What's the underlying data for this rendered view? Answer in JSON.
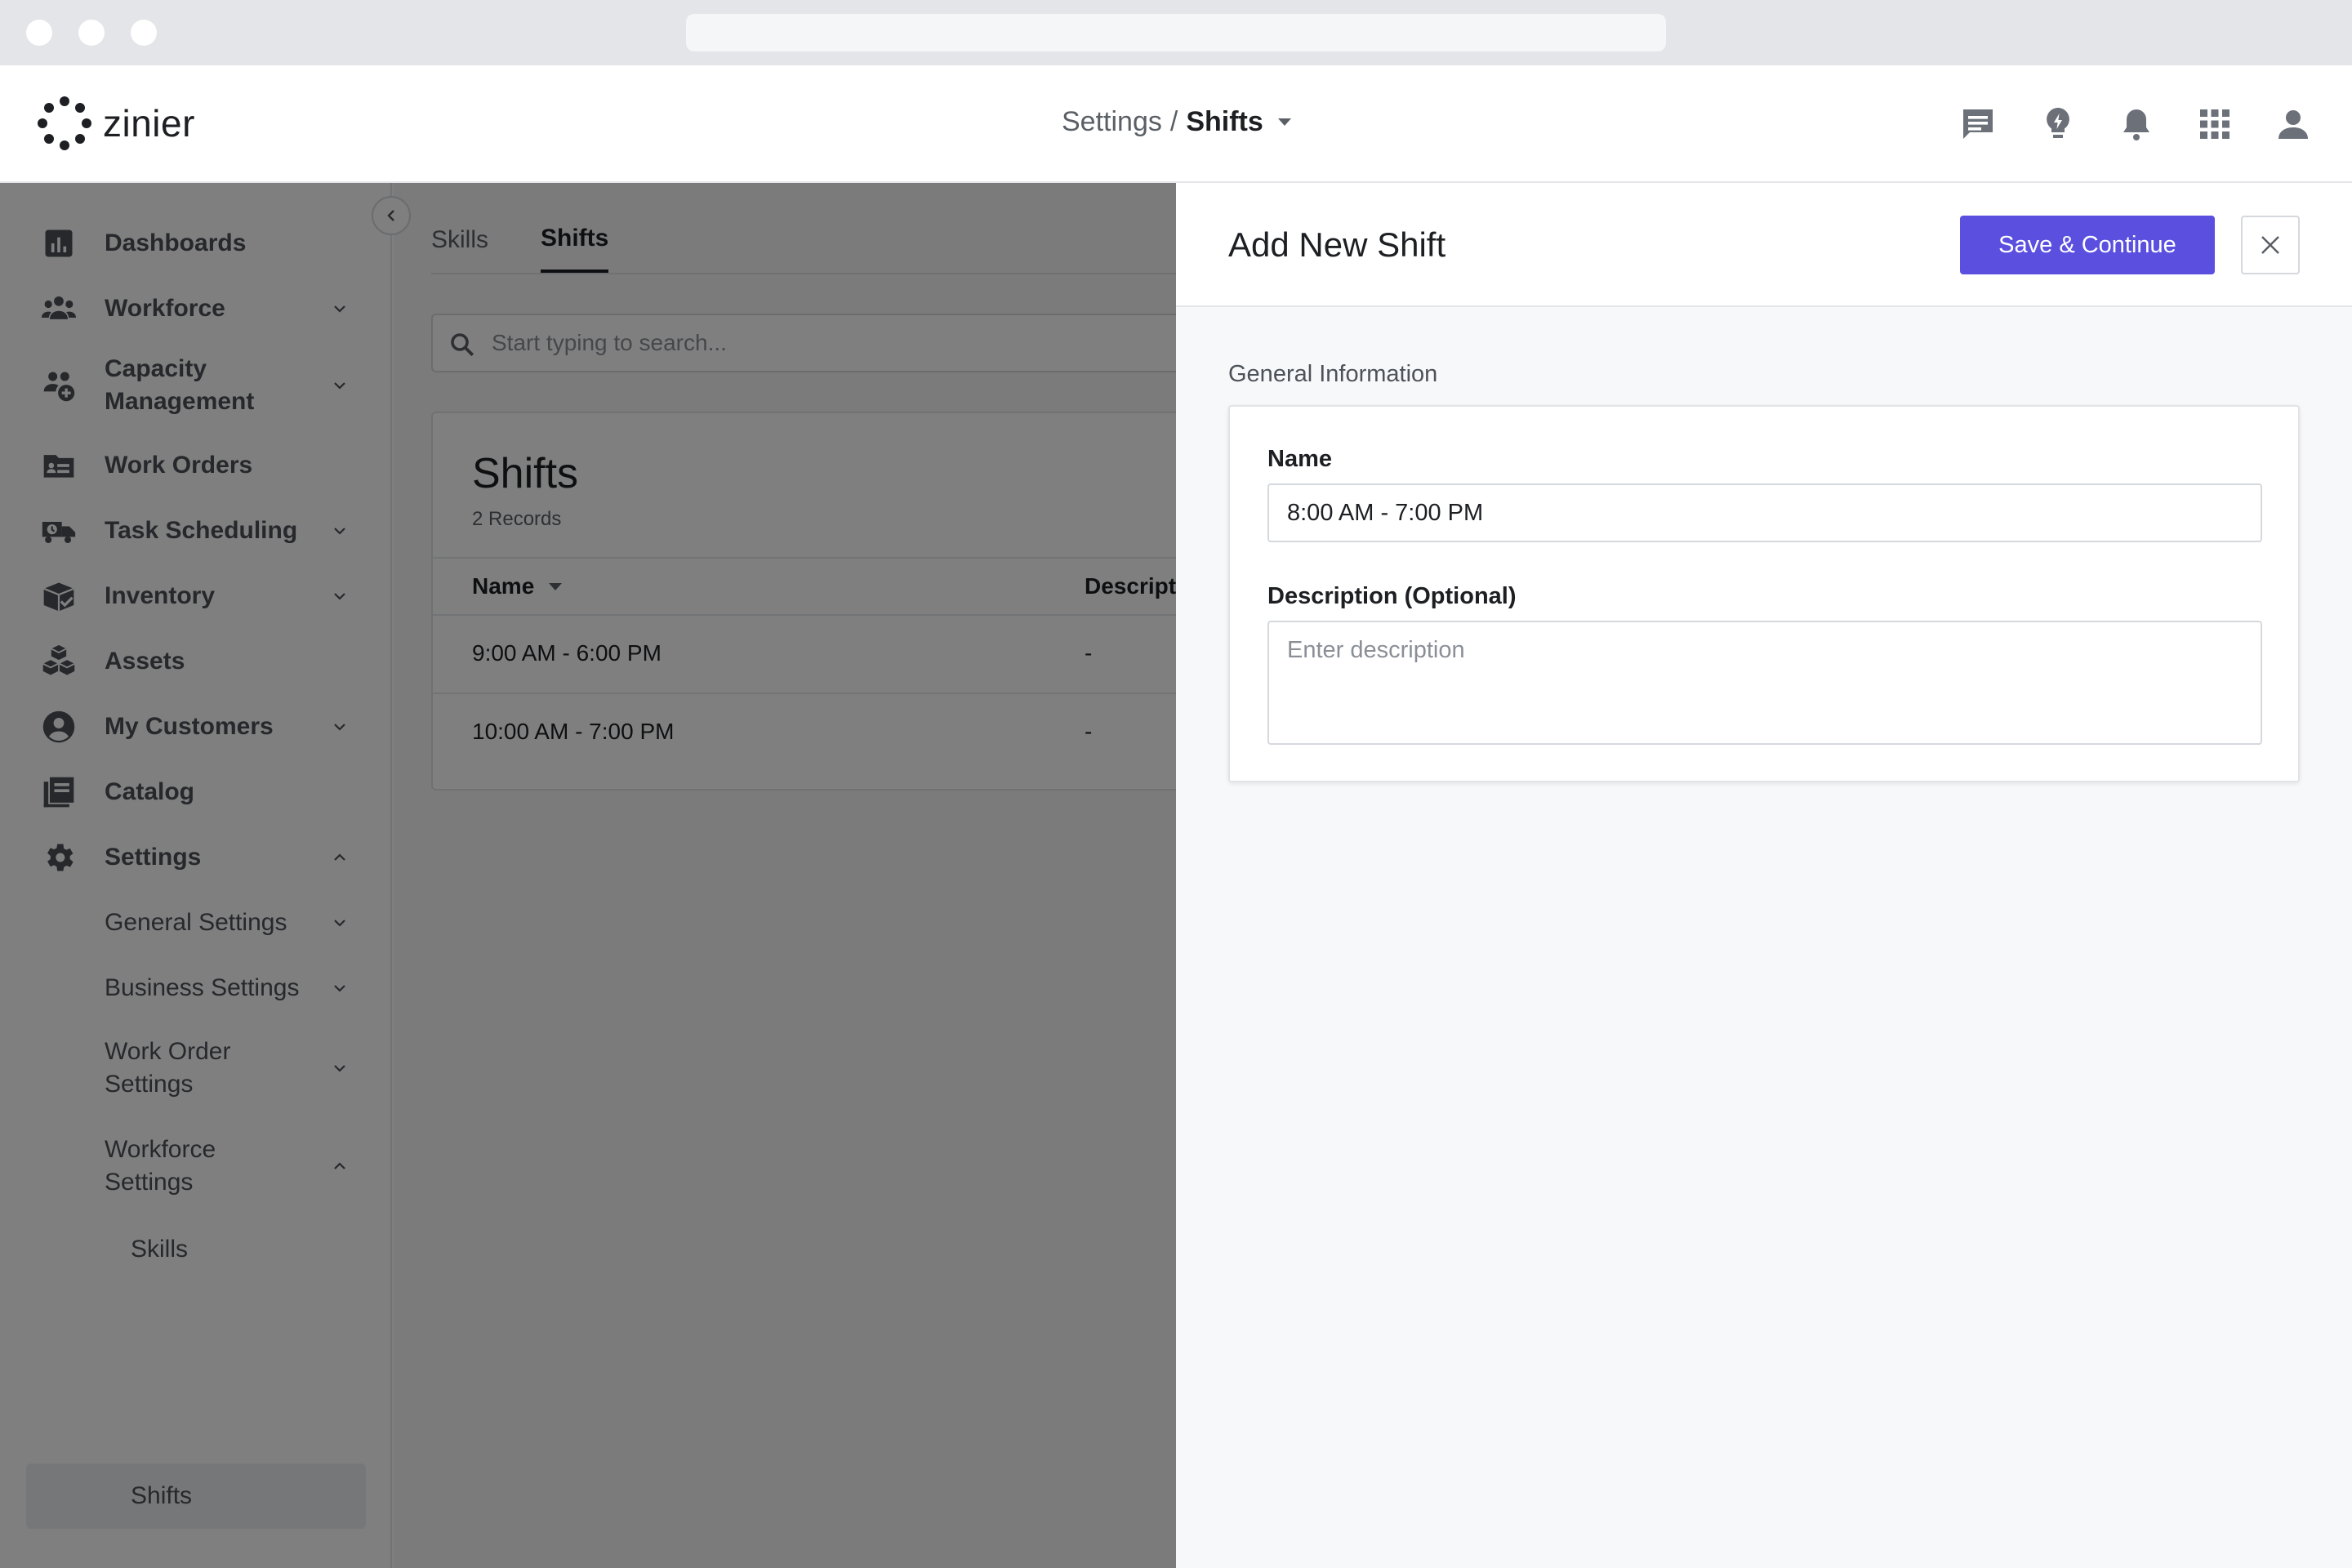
{
  "app": {
    "brand": "zinier"
  },
  "header": {
    "breadcrumb_parent": "Settings",
    "breadcrumb_sep": "/",
    "breadcrumb_current": "Shifts",
    "icons": [
      "chat-icon",
      "lightbulb-icon",
      "bell-icon",
      "apps-grid-icon",
      "user-icon"
    ]
  },
  "sidebar": {
    "items": [
      {
        "label": "Dashboards",
        "icon": "dashboard-icon"
      },
      {
        "label": "Workforce",
        "icon": "people-icon"
      },
      {
        "label_line1": "Capacity",
        "label_line2": "Management",
        "icon": "capacity-icon"
      },
      {
        "label": "Work Orders",
        "icon": "work-orders-icon"
      },
      {
        "label": "Task Scheduling",
        "icon": "truck-clock-icon"
      },
      {
        "label": "Inventory",
        "icon": "inventory-box-icon"
      },
      {
        "label": "Assets",
        "icon": "cubes-icon"
      },
      {
        "label": "My Customers",
        "icon": "customer-icon"
      },
      {
        "label": "Catalog",
        "icon": "book-icon"
      },
      {
        "label": "Settings",
        "icon": "gear-icon"
      }
    ],
    "settings_children": [
      {
        "label": "General Settings"
      },
      {
        "label": "Business Settings"
      },
      {
        "label_line1": "Work Order",
        "label_line2": "Settings"
      },
      {
        "label_line1": "Workforce",
        "label_line2": "Settings"
      }
    ],
    "workforce_children": [
      {
        "label": "Skills"
      },
      {
        "label": "Shifts"
      }
    ]
  },
  "main": {
    "tabs": [
      {
        "label": "Skills"
      },
      {
        "label": "Shifts"
      }
    ],
    "search_placeholder": "Start typing to search...",
    "card_title": "Shifts",
    "record_count": "2 Records",
    "columns": [
      {
        "label": "Name"
      },
      {
        "label": "Descript"
      }
    ],
    "rows": [
      {
        "name": "9:00 AM - 6:00 PM",
        "description": "-"
      },
      {
        "name": "10:00 AM - 7:00 PM",
        "description": "-"
      }
    ]
  },
  "drawer": {
    "title": "Add New Shift",
    "save_label": "Save & Continue",
    "section_label": "General Information",
    "name_label": "Name",
    "name_value": "8:00 AM - 7:00 PM",
    "description_label": "Description (Optional)",
    "description_placeholder": "Enter description"
  },
  "colors": {
    "accent": "#5b4fe0",
    "overlay": "rgba(0,0,0,0.5)"
  }
}
